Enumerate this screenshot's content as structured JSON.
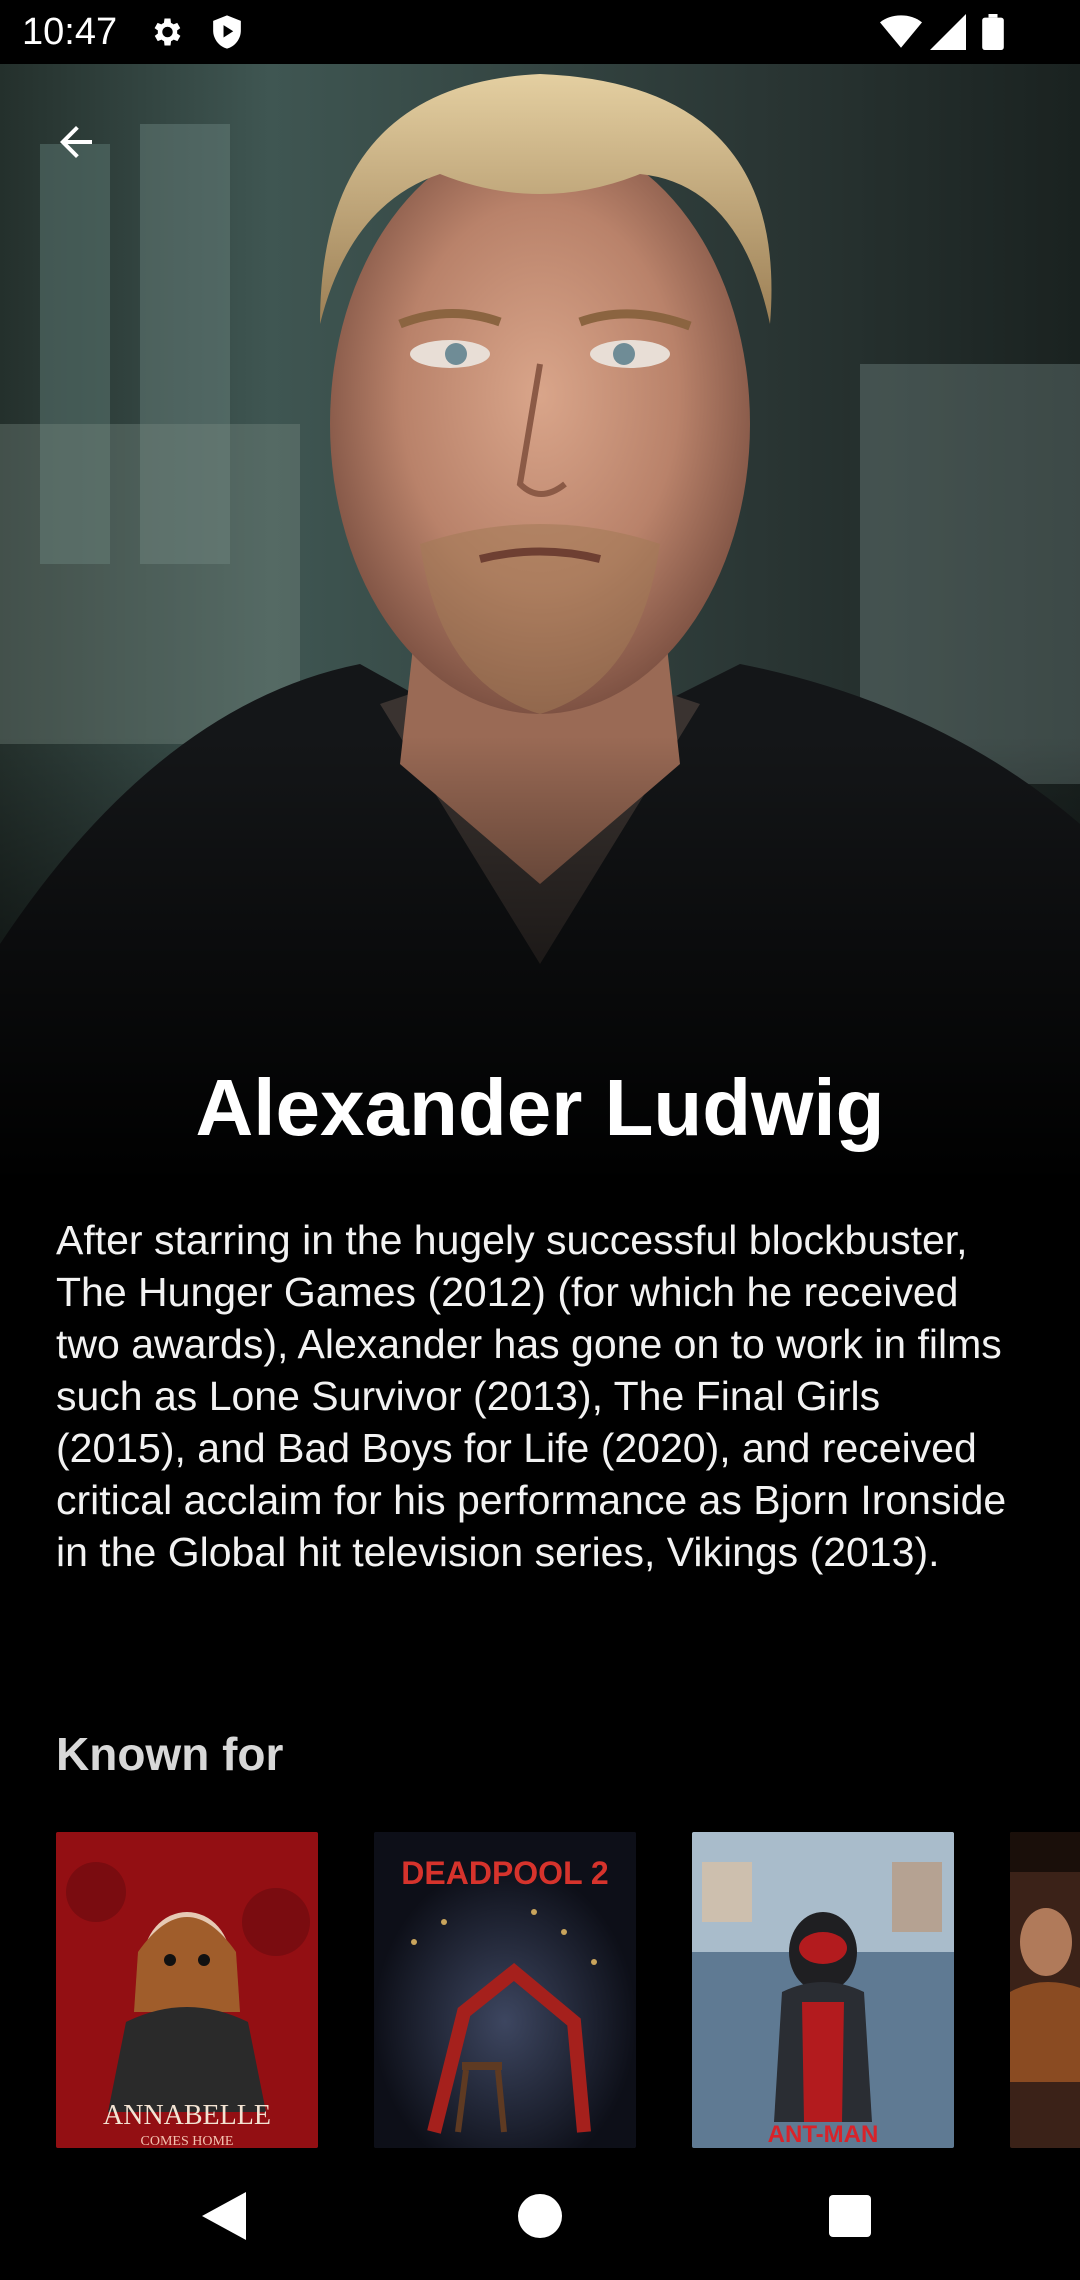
{
  "status_bar": {
    "time": "10:47",
    "icons_left": [
      "gear-icon",
      "shield-play-icon"
    ],
    "icons_right": [
      "wifi-icon",
      "signal-icon",
      "battery-icon"
    ]
  },
  "header": {
    "back_icon": "arrow-left-icon"
  },
  "person": {
    "name": "Alexander Ludwig",
    "bio": "After starring in the hugely successful blockbuster, The Hunger Games (2012) (for which he received two awards), Alexander has gone on to work in films such as Lone Survivor (2013), The Final Girls (2015), and Bad Boys for Life (2020), and received critical acclaim for his performance as Bjorn Ironside in the Global hit television series, Vikings (2013)."
  },
  "known_for": {
    "title": "Known for",
    "posters": [
      {
        "label": "ANNABELLE",
        "sublabel": "COMES HOME",
        "color": "#b3141a"
      },
      {
        "label": "DEADPOOL 2",
        "sublabel": "",
        "color": "#0d0f18"
      },
      {
        "label": "ANT-MAN",
        "sublabel": "",
        "color": "#5f7a93"
      },
      {
        "label": "",
        "sublabel": "",
        "color": "#3b2218"
      }
    ]
  },
  "nav_bar": {
    "icons": [
      "back-triangle-icon",
      "home-circle-icon",
      "recents-square-icon"
    ]
  },
  "colors": {
    "background": "#000000",
    "text": "#ffffff",
    "section_title": "#d8d8d8"
  }
}
